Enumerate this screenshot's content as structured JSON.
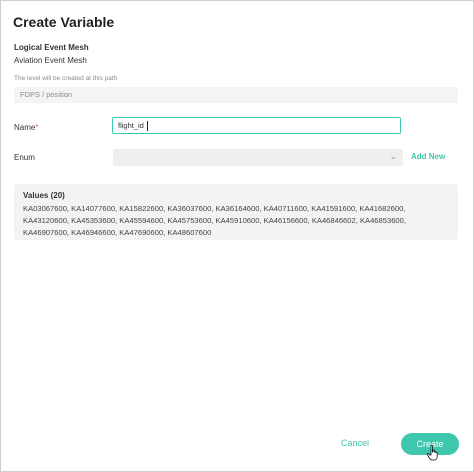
{
  "dialog": {
    "title": "Create Variable",
    "mesh_label": "Logical Event Mesh",
    "mesh_value": "Aviation Event Mesh",
    "path_hint": "The level will be created at this path",
    "path_value": "FDPS / position"
  },
  "form": {
    "name_label": "Name",
    "name_required_mark": "*",
    "name_value": "flight_id",
    "enum_label": "Enum",
    "enum_selected": "",
    "add_new_label": "Add New",
    "accent_color": "#3ec7ad"
  },
  "values": {
    "title": "Values (20)",
    "list": "KA03067600, KA14077600, KA15822600, KA36037600, KA36164600, KA40711600, KA41591600, KA41682600, KA43120600, KA45353600, KA45594600, KA45753600, KA45910600, KA46156600, KA46846602, KA46853600, KA46907600, KA46946600, KA47690600, KA48607600"
  },
  "footer": {
    "cancel_label": "Cancel",
    "create_label": "Create"
  },
  "icons": {
    "enum_dropdown": "chevron-down-icon",
    "pointer": "hand-cursor-icon"
  }
}
